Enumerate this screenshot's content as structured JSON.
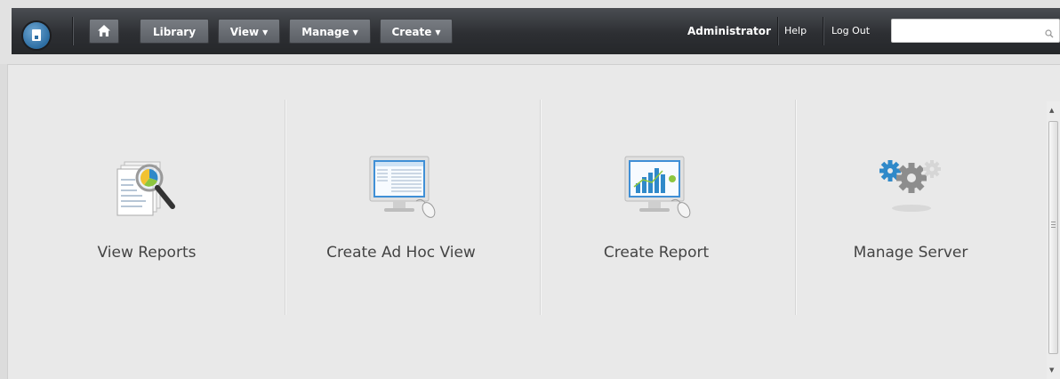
{
  "nav": {
    "library": "Library",
    "view": "View",
    "manage": "Manage",
    "create": "Create",
    "user": "Administrator",
    "help": "Help",
    "logout": "Log Out",
    "search_value": ""
  },
  "tiles": [
    {
      "label": "View Reports",
      "icon": "view-reports-icon"
    },
    {
      "label": "Create Ad Hoc View",
      "icon": "adhoc-view-icon"
    },
    {
      "label": "Create Report",
      "icon": "create-report-icon"
    },
    {
      "label": "Manage Server",
      "icon": "manage-server-icon"
    }
  ],
  "colors": {
    "nav_bg": "#2d2f33",
    "button_bg": "#6a6e74",
    "accent_blue": "#3f8fd6",
    "accent_green": "#8cc63f"
  }
}
